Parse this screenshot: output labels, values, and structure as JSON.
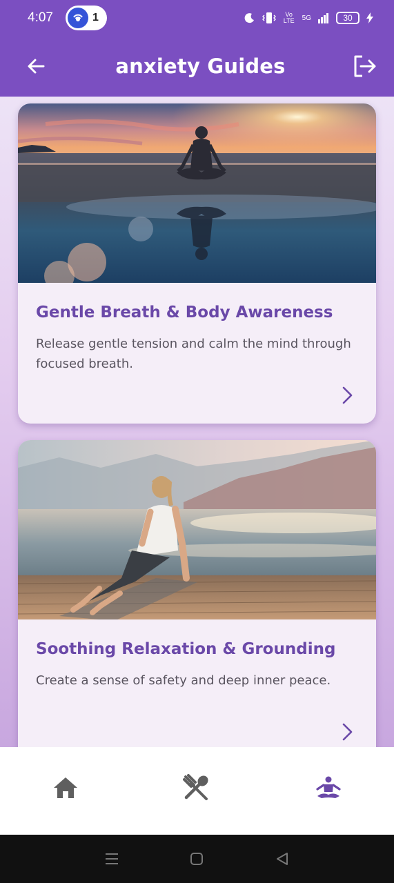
{
  "status_bar": {
    "time": "4:07",
    "notification_count": "1",
    "network_label": "5G",
    "volte_label": "Vo LTE",
    "battery_level": "30"
  },
  "app_bar": {
    "title": "anxiety Guides",
    "back_icon": "arrow-left-icon",
    "logout_icon": "logout-icon"
  },
  "guides": [
    {
      "title": "Gentle Breath & Body Awareness",
      "description": "Release gentle tension and calm the mind through focused breath.",
      "image": "meditation-sunset-beach"
    },
    {
      "title": "Soothing Relaxation & Grounding",
      "description": "Create a sense of safety and deep inner peace.",
      "image": "yoga-cobra-pose-lake-dock"
    }
  ],
  "bottom_nav": {
    "items": [
      {
        "name": "home",
        "icon": "home-icon",
        "active": false
      },
      {
        "name": "nutrition",
        "icon": "fork-spoon-icon",
        "active": false
      },
      {
        "name": "meditation",
        "icon": "meditation-icon",
        "active": true
      }
    ]
  },
  "colors": {
    "primary": "#7b4fc1",
    "title_purple": "#6a48a8",
    "inactive_icon": "#5f5f5f",
    "active_icon": "#6a48a8"
  }
}
